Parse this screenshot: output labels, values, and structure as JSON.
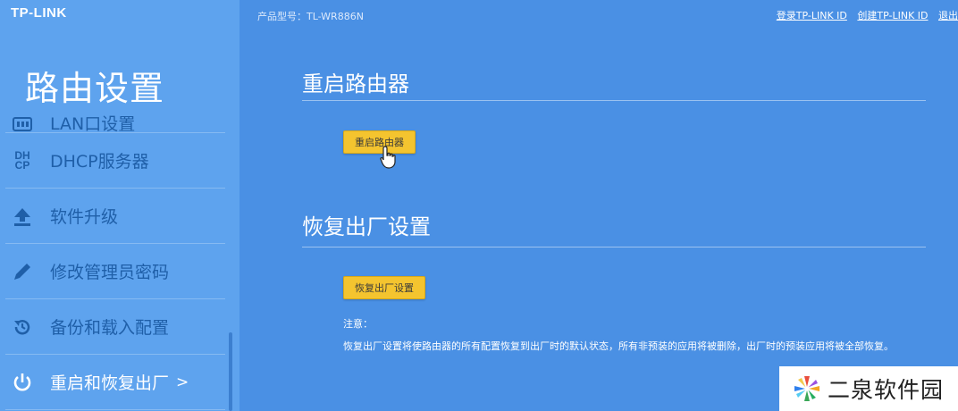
{
  "brand": "TP-LINK",
  "product_model": "产品型号：TL-WR886N",
  "top_links": [
    "登录TP-LINK ID",
    "创建TP-LINK ID",
    "退出"
  ],
  "sidebar": {
    "title": "路由设置",
    "items": [
      {
        "label": "LAN口设置",
        "icon": "lan-icon"
      },
      {
        "label": "DHCP服务器",
        "icon": "dhcp-icon"
      },
      {
        "label": "软件升级",
        "icon": "upload-icon"
      },
      {
        "label": "修改管理员密码",
        "icon": "pencil-icon"
      },
      {
        "label": "备份和载入配置",
        "icon": "restore-icon"
      },
      {
        "label": "重启和恢复出厂",
        "icon": "power-icon",
        "active": true,
        "chevron": ">"
      }
    ]
  },
  "reboot": {
    "title": "重启路由器",
    "button_label": "重启路由器"
  },
  "factory_reset": {
    "title": "恢复出厂设置",
    "button_label": "恢复出厂设置",
    "note_label": "注意：",
    "note_text": "恢复出厂设置将使路由器的所有配置恢复到出厂时的默认状态，所有非预装的应用将被删除，出厂时的预装应用将被全部恢复。"
  },
  "watermark": "二泉软件园",
  "colors": {
    "background": "#4a90e4",
    "sidebar": "#5ea3ee",
    "button": "#f4c42f",
    "menu_text": "#1f5fa8"
  }
}
